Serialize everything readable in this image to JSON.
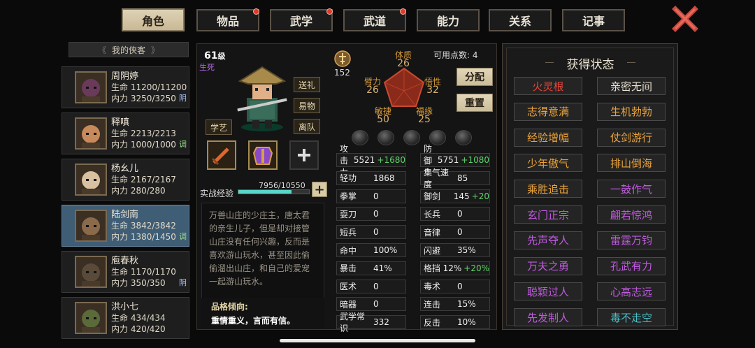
{
  "tabs": [
    {
      "label": "角色",
      "active": true,
      "badge": false
    },
    {
      "label": "物品",
      "active": false,
      "badge": true
    },
    {
      "label": "武学",
      "active": false,
      "badge": true
    },
    {
      "label": "武道",
      "active": false,
      "badge": true
    },
    {
      "label": "能力",
      "active": false,
      "badge": false
    },
    {
      "label": "关系",
      "active": false,
      "badge": false
    },
    {
      "label": "记事",
      "active": false,
      "badge": false
    }
  ],
  "close_icon": "close-x-icon",
  "party": {
    "header": "我的侠客",
    "members": [
      {
        "name": "周阴婷",
        "hp": "生命 11200/11200",
        "mp": "内力 3250/3250",
        "status": "阴"
      },
      {
        "name": "释嗔",
        "hp": "生命 2213/2213",
        "mp": "内力 1000/1000",
        "status": "调"
      },
      {
        "name": "杨幺儿",
        "hp": "生命 2167/2167",
        "mp": "内力 280/280",
        "status": ""
      },
      {
        "name": "陆剑南",
        "hp": "生命 3842/3842",
        "mp": "内力 1380/1450",
        "status": "调"
      },
      {
        "name": "庖春秋",
        "hp": "生命 1170/1170",
        "mp": "内力 350/350",
        "status": "阴"
      },
      {
        "name": "洪小七",
        "hp": "生命 434/434",
        "mp": "内力 420/420",
        "status": ""
      }
    ]
  },
  "character": {
    "level": "61",
    "level_suffix": "级",
    "realm": "生死",
    "buttons": {
      "gift": "送礼",
      "change": "易物",
      "leave": "离队",
      "learn": "学艺"
    },
    "exp_label": "实战经验",
    "exp_text": "7956/10550",
    "exp_fraction": 0.754,
    "description": "万兽山庄的少庄主，唐太君的亲生儿子，但是却对接管山庄没有任何兴趣，反而是喜欢游山玩水，甚至因此偷偷溜出山庄，和自己的爱宠一起游山玩水。",
    "trait_title": "品格倾向:",
    "trait_text": "重情重义，言而有信。",
    "power": "152"
  },
  "attributes": {
    "tizhi": {
      "label": "体质",
      "value": "26"
    },
    "bili": {
      "label": "臂力",
      "value": "26"
    },
    "wuxing": {
      "label": "悟性",
      "value": "32"
    },
    "minjie": {
      "label": "敏捷",
      "value": "50"
    },
    "fuyuan": {
      "label": "福缘",
      "value": "25"
    },
    "points_label": "可用点数:",
    "points": "4",
    "alloc": "分配",
    "reset": "重置"
  },
  "stats": [
    {
      "k": "攻击力",
      "v": "5521",
      "b": "+1680"
    },
    {
      "k": "防御力",
      "v": "5751",
      "b": "+1080"
    },
    {
      "k": "轻功",
      "v": "1868",
      "b": ""
    },
    {
      "k": "集气速度",
      "v": "85",
      "b": ""
    },
    {
      "k": "拳掌",
      "v": "0",
      "b": ""
    },
    {
      "k": "御剑",
      "v": "145",
      "b": "+20"
    },
    {
      "k": "耍刀",
      "v": "0",
      "b": ""
    },
    {
      "k": "长兵",
      "v": "0",
      "b": ""
    },
    {
      "k": "短兵",
      "v": "0",
      "b": ""
    },
    {
      "k": "音律",
      "v": "0",
      "b": ""
    },
    {
      "k": "命中",
      "v": "100%",
      "b": ""
    },
    {
      "k": "闪避",
      "v": "35%",
      "b": ""
    },
    {
      "k": "暴击",
      "v": "41%",
      "b": ""
    },
    {
      "k": "格挡",
      "v": "12%",
      "b": "+20%"
    },
    {
      "k": "医术",
      "v": "0",
      "b": ""
    },
    {
      "k": "毒术",
      "v": "0",
      "b": ""
    },
    {
      "k": "暗器",
      "v": "0",
      "b": ""
    },
    {
      "k": "连击",
      "v": "15%",
      "b": ""
    },
    {
      "k": "武学常识",
      "v": "332",
      "b": ""
    },
    {
      "k": "反击",
      "v": "10%",
      "b": ""
    }
  ],
  "status_panel": {
    "title": "获得状态",
    "items": [
      {
        "t": "火灵根",
        "c": "#e0463a"
      },
      {
        "t": "亲密无间",
        "c": "#e8e0d0"
      },
      {
        "t": "志得意满",
        "c": "#e8a23a"
      },
      {
        "t": "生机勃勃",
        "c": "#e8a23a"
      },
      {
        "t": "经验增幅",
        "c": "#e8a23a"
      },
      {
        "t": "仗剑游行",
        "c": "#e8a23a"
      },
      {
        "t": "少年傲气",
        "c": "#e8a23a"
      },
      {
        "t": "排山倒海",
        "c": "#e8a23a"
      },
      {
        "t": "乘胜追击",
        "c": "#e8a23a"
      },
      {
        "t": "一鼓作气",
        "c": "#c05ae0"
      },
      {
        "t": "玄门正宗",
        "c": "#c05ae0"
      },
      {
        "t": "翩若惊鸿",
        "c": "#c05ae0"
      },
      {
        "t": "先声夺人",
        "c": "#c05ae0"
      },
      {
        "t": "雷霆万钧",
        "c": "#c05ae0"
      },
      {
        "t": "万夫之勇",
        "c": "#c05ae0"
      },
      {
        "t": "孔武有力",
        "c": "#c05ae0"
      },
      {
        "t": "聪颖过人",
        "c": "#c05ae0"
      },
      {
        "t": "心高志远",
        "c": "#c05ae0"
      },
      {
        "t": "先发制人",
        "c": "#c05ae0"
      },
      {
        "t": "毒不走空",
        "c": "#4ac0c8"
      }
    ]
  }
}
